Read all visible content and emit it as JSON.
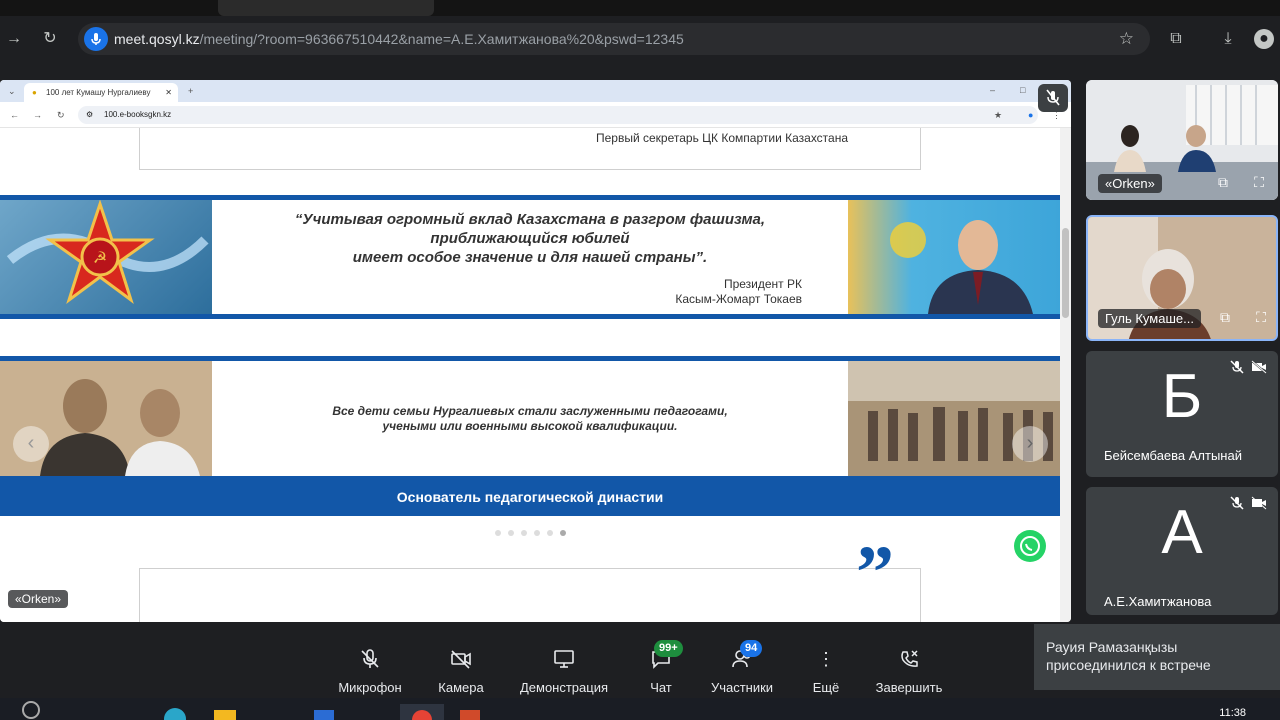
{
  "browser": {
    "url_host": "meet.qosyl.kz",
    "url_path": "/meeting/?room=963667510442&name=А.Е.Хамитжанова%20&pswd=12345"
  },
  "shared_browser": {
    "tab_title": "100 лет Кумашу Нургалиеву",
    "url": "100.e-booksgkn.kz"
  },
  "page": {
    "top_card_caption": "Первый секретарь ЦК Компартии Казахстана",
    "quote_line1": "“Учитывая огромный вклад Казахстана в разгром фашизма,",
    "quote_line2": "приближающийся юбилей",
    "quote_line3": "имеет особое значение и для нашей страны”.",
    "quote_author1": "Президент РК",
    "quote_author2": "Касым-Жомарт Токаев",
    "family_text1": "Все дети семьи Нургалиевых стали заслуженными педагогами,",
    "family_text2": "учеными или военными высокой квалификации.",
    "dynasty_title": "Основатель педагогической династии",
    "quote_mark": "”"
  },
  "presenter_label": "«Orken»",
  "participants": [
    {
      "name": "«Orken»",
      "type": "video"
    },
    {
      "name": "Гуль Кумаше...",
      "type": "video"
    },
    {
      "name": "Бейсембаева Алтынай",
      "letter": "Б",
      "type": "avatar"
    },
    {
      "name": "А.Е.Хамитжанова",
      "letter": "А",
      "type": "avatar"
    }
  ],
  "controls": {
    "mic": "Микрофон",
    "camera": "Камера",
    "share": "Демонстрация",
    "chat": "Чат",
    "chat_badge": "99+",
    "participants": "Участники",
    "participants_badge": "94",
    "more": "Ещё",
    "end": "Завершить"
  },
  "toast": {
    "line1": "Рауия Рамазанқызы",
    "line2": "присоединился к встрече"
  },
  "taskbar": {
    "clock": "11:38"
  },
  "colors": {
    "banner_blue": "#1257a8",
    "chat_badge": "#1e8e3e",
    "participants_badge": "#1a73e8",
    "whatsapp": "#25d366",
    "active_tile_border": "#8ab4f8"
  }
}
